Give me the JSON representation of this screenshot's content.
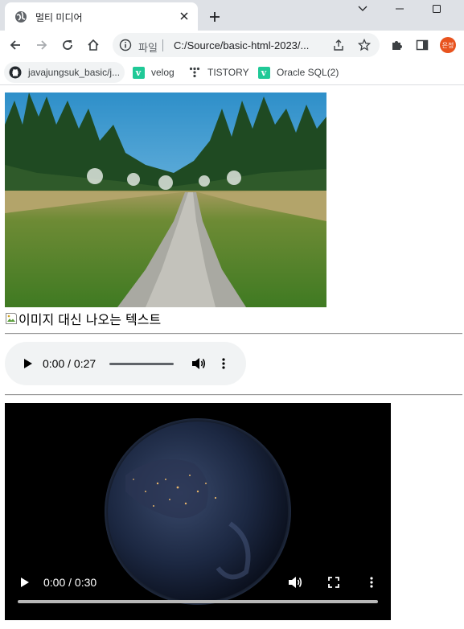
{
  "browser": {
    "tab_title": "멀티 미디어",
    "url_scheme": "파일",
    "url": "C:/Source/basic-html-2023/...",
    "profile_initials": "은정",
    "bookmarks": [
      {
        "label": "javajungsuk_basic/j...",
        "icon": "github-icon"
      },
      {
        "label": "velog",
        "icon": "velog-icon"
      },
      {
        "label": "TISTORY",
        "icon": "tistory-icon"
      },
      {
        "label": "Oracle SQL(2)",
        "icon": "velog-icon"
      }
    ]
  },
  "page": {
    "image_alt": "이미지 대신 나오는 텍스트",
    "audio": {
      "time": "0:00 / 0:27"
    },
    "video": {
      "time": "0:00 / 0:30"
    }
  },
  "colors": {
    "tabstrip": "#dee1e6",
    "omnibox": "#f1f3f4",
    "avatar": "#e8531e",
    "velog_brand": "#20c997"
  }
}
